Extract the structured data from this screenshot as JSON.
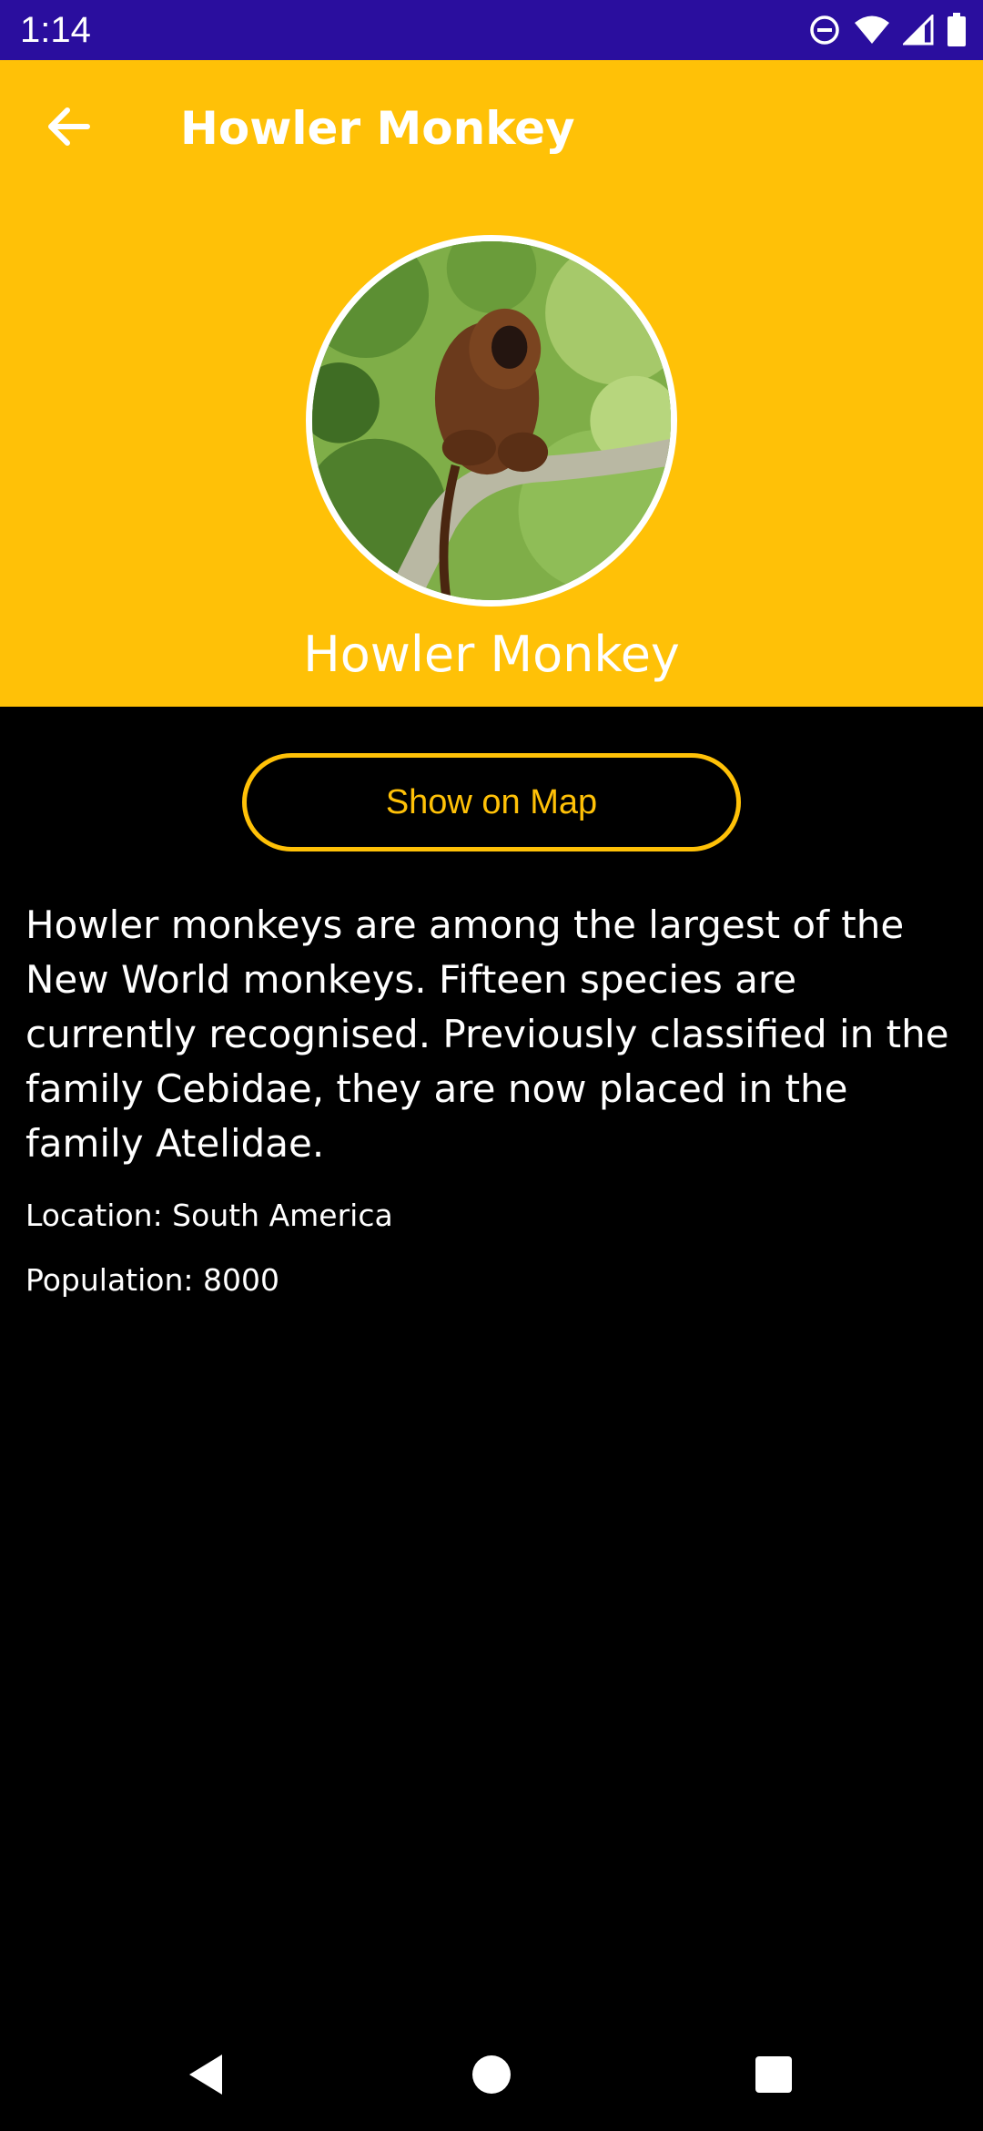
{
  "status_bar": {
    "time": "1:14",
    "icons": [
      "do-not-disturb-icon",
      "wifi-icon",
      "cellular-signal-icon",
      "battery-icon"
    ],
    "background": "#2A0E9E"
  },
  "toolbar": {
    "back_icon": "arrow-left-icon",
    "title": "Howler Monkey",
    "background": "#FFC107"
  },
  "profile": {
    "image": "howler-monkey-photo",
    "name": "Howler Monkey"
  },
  "actions": {
    "show_on_map_label": "Show on Map",
    "accent": "#FFC107"
  },
  "details": {
    "description": "Howler monkeys are among the largest of the New World monkeys. Fifteen species are currently recognised. Previously classified in the family Cebidae, they are now placed in the family Atelidae.",
    "location": "Location: South America",
    "population": "Population: 8000"
  },
  "nav_bar": {
    "icons": [
      "nav-back-icon",
      "nav-home-icon",
      "nav-recents-icon"
    ]
  }
}
